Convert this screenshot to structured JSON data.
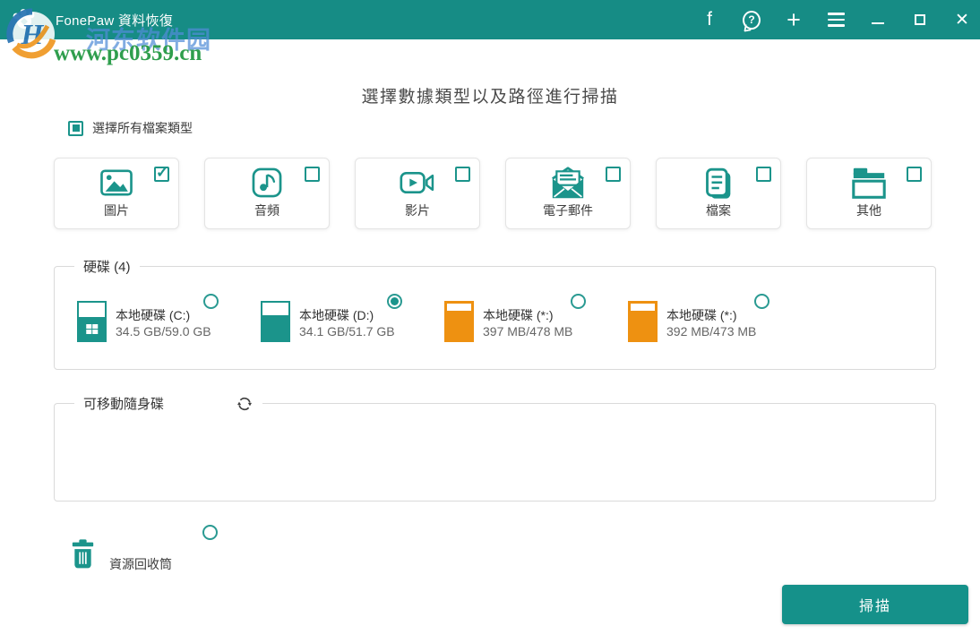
{
  "titlebar": {
    "app_title": "FonePaw 資料恢復",
    "icons": {
      "facebook_glyph": "f",
      "help_glyph": "?",
      "plus_glyph": "+",
      "close_glyph": "✕"
    }
  },
  "watermark": {
    "site_name": "河东软件园",
    "site_url": "www.pc0359.cn"
  },
  "main": {
    "heading": "選擇數據類型以及路徑進行掃描",
    "select_all_label": "選擇所有檔案類型",
    "file_types": [
      {
        "label": "圖片",
        "icon": "image-icon",
        "checked": true
      },
      {
        "label": "音頻",
        "icon": "audio-icon",
        "checked": false
      },
      {
        "label": "影片",
        "icon": "video-icon",
        "checked": false
      },
      {
        "label": "電子郵件",
        "icon": "email-icon",
        "checked": false
      },
      {
        "label": "檔案",
        "icon": "document-icon",
        "checked": false
      },
      {
        "label": "其他",
        "icon": "folder-icon",
        "checked": false
      }
    ],
    "hdd_section": {
      "legend": "硬碟 (4)",
      "drives": [
        {
          "name": "本地硬碟 (C:)",
          "capacity": "34.5 GB/59.0 GB",
          "color": "teal",
          "selected": false,
          "system_drive": true
        },
        {
          "name": "本地硬碟 (D:)",
          "capacity": "34.1 GB/51.7 GB",
          "color": "teal",
          "selected": true,
          "system_drive": false
        },
        {
          "name": "本地硬碟 (*:)",
          "capacity": "397 MB/478 MB",
          "color": "orange",
          "selected": false,
          "system_drive": false
        },
        {
          "name": "本地硬碟 (*:)",
          "capacity": "392 MB/473 MB",
          "color": "orange",
          "selected": false,
          "system_drive": false
        }
      ]
    },
    "removable_section": {
      "legend": "可移動隨身碟",
      "drives": []
    },
    "recycle_bin": {
      "label": "資源回收筒",
      "selected": false
    },
    "scan_button_label": "掃描"
  },
  "colors": {
    "titlebar_teal": "#168c85",
    "accent_teal": "#1b948b",
    "drive_orange": "#ee9111",
    "watermark_green": "#2f9e4d",
    "watermark_blue": "#508cd7"
  }
}
